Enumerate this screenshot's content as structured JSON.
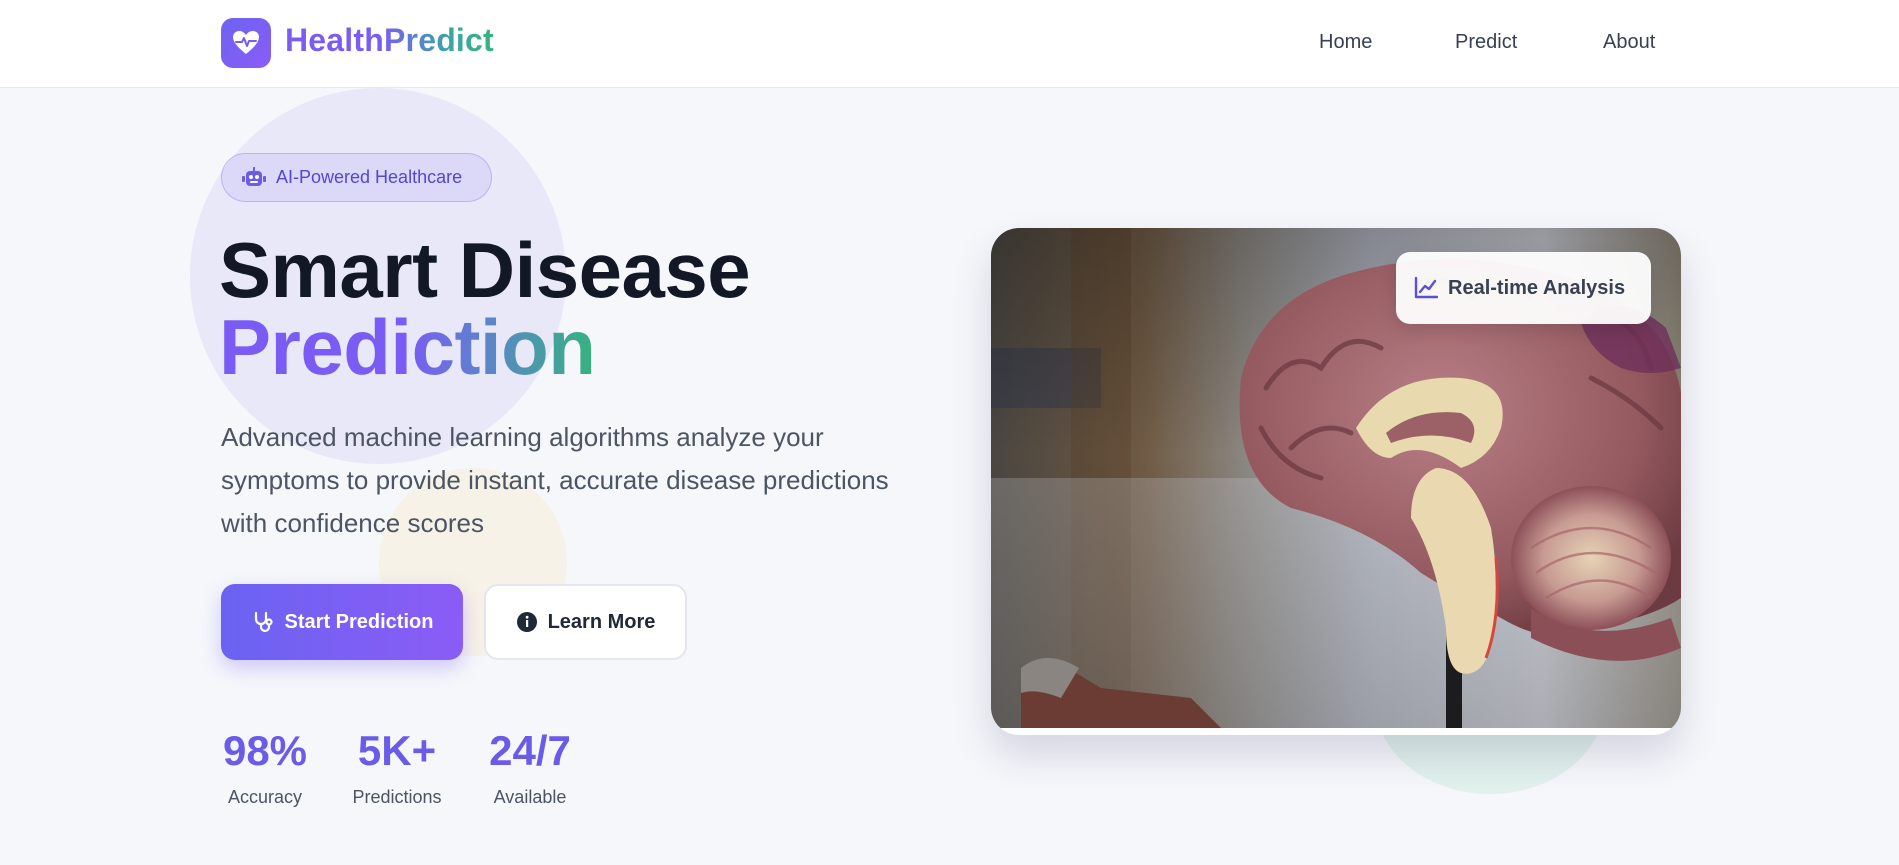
{
  "header": {
    "logo_icon": "heart-pulse-icon",
    "app_name": "HealthPredict",
    "nav": [
      {
        "label": "Home"
      },
      {
        "label": "Predict"
      },
      {
        "label": "About"
      }
    ]
  },
  "hero": {
    "badge": {
      "icon": "robot-icon",
      "label": "AI-Powered Healthcare"
    },
    "title_line1": "Smart Disease",
    "title_line2": "Prediction",
    "description": "Advanced machine learning algorithms analyze your symptoms to provide instant, accurate disease predictions with confidence scores",
    "primary_button": {
      "icon": "stethoscope-icon",
      "label": "Start Prediction"
    },
    "secondary_button": {
      "icon": "info-icon",
      "label": "Learn More"
    },
    "stats": [
      {
        "value": "98%",
        "label": "Accuracy"
      },
      {
        "value": "5K+",
        "label": "Predictions"
      },
      {
        "value": "24/7",
        "label": "Available"
      }
    ]
  },
  "image_card": {
    "subject": "brain-model-photo",
    "chip": {
      "icon": "line-chart-icon",
      "label": "Real-time Analysis"
    }
  },
  "colors": {
    "brand_purple": "#7a5cf4",
    "brand_green": "#36b37e",
    "primary_button": "#6a63f1",
    "text_dark": "#121826"
  }
}
